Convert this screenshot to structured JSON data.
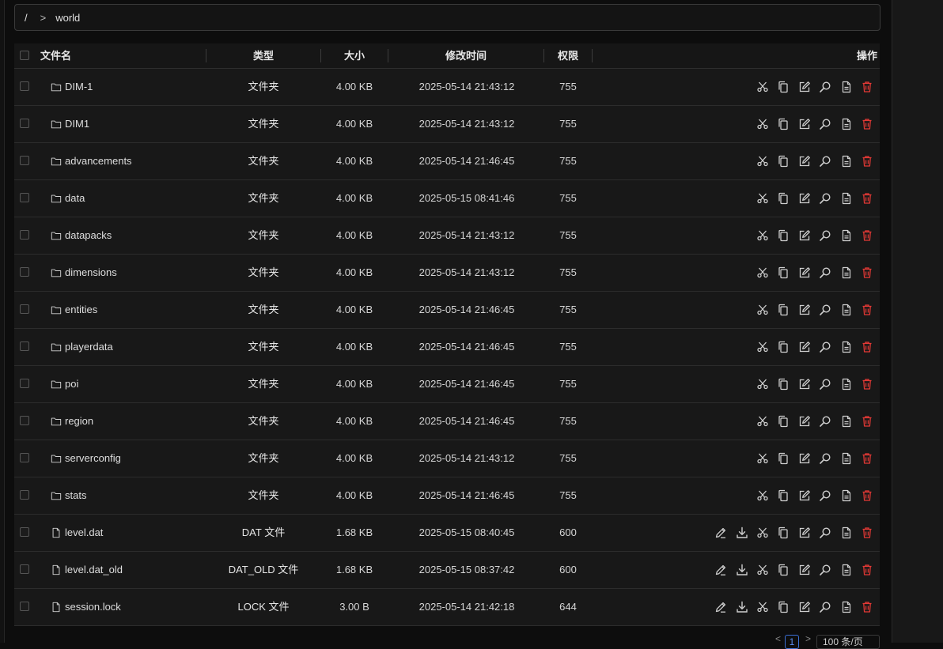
{
  "breadcrumb": {
    "root": "/",
    "separator": ">",
    "current": "world"
  },
  "table": {
    "headers": {
      "name": "文件名",
      "type": "类型",
      "size": "大小",
      "modified": "修改时间",
      "permission": "权限",
      "actions": "操作"
    },
    "rows": [
      {
        "name": "DIM-1",
        "kind": "folder",
        "type": "文件夹",
        "size": "4.00 KB",
        "modified": "2025-05-14 21:43:12",
        "permission": "755"
      },
      {
        "name": "DIM1",
        "kind": "folder",
        "type": "文件夹",
        "size": "4.00 KB",
        "modified": "2025-05-14 21:43:12",
        "permission": "755"
      },
      {
        "name": "advancements",
        "kind": "folder",
        "type": "文件夹",
        "size": "4.00 KB",
        "modified": "2025-05-14 21:46:45",
        "permission": "755"
      },
      {
        "name": "data",
        "kind": "folder",
        "type": "文件夹",
        "size": "4.00 KB",
        "modified": "2025-05-15 08:41:46",
        "permission": "755"
      },
      {
        "name": "datapacks",
        "kind": "folder",
        "type": "文件夹",
        "size": "4.00 KB",
        "modified": "2025-05-14 21:43:12",
        "permission": "755"
      },
      {
        "name": "dimensions",
        "kind": "folder",
        "type": "文件夹",
        "size": "4.00 KB",
        "modified": "2025-05-14 21:43:12",
        "permission": "755"
      },
      {
        "name": "entities",
        "kind": "folder",
        "type": "文件夹",
        "size": "4.00 KB",
        "modified": "2025-05-14 21:46:45",
        "permission": "755"
      },
      {
        "name": "playerdata",
        "kind": "folder",
        "type": "文件夹",
        "size": "4.00 KB",
        "modified": "2025-05-14 21:46:45",
        "permission": "755"
      },
      {
        "name": "poi",
        "kind": "folder",
        "type": "文件夹",
        "size": "4.00 KB",
        "modified": "2025-05-14 21:46:45",
        "permission": "755"
      },
      {
        "name": "region",
        "kind": "folder",
        "type": "文件夹",
        "size": "4.00 KB",
        "modified": "2025-05-14 21:46:45",
        "permission": "755"
      },
      {
        "name": "serverconfig",
        "kind": "folder",
        "type": "文件夹",
        "size": "4.00 KB",
        "modified": "2025-05-14 21:43:12",
        "permission": "755"
      },
      {
        "name": "stats",
        "kind": "folder",
        "type": "文件夹",
        "size": "4.00 KB",
        "modified": "2025-05-14 21:46:45",
        "permission": "755"
      },
      {
        "name": "level.dat",
        "kind": "file",
        "type": "DAT 文件",
        "size": "1.68 KB",
        "modified": "2025-05-15 08:40:45",
        "permission": "600"
      },
      {
        "name": "level.dat_old",
        "kind": "file",
        "type": "DAT_OLD 文件",
        "size": "1.68 KB",
        "modified": "2025-05-15 08:37:42",
        "permission": "600"
      },
      {
        "name": "session.lock",
        "kind": "file",
        "type": "LOCK 文件",
        "size": "3.00 B",
        "modified": "2025-05-14 21:42:18",
        "permission": "644"
      }
    ],
    "folder_actions": [
      "scissors-icon",
      "copy-icon",
      "rename-icon",
      "search-icon",
      "file-details-icon",
      "delete-icon"
    ],
    "file_actions": [
      "edit-icon",
      "download-icon",
      "scissors-icon",
      "copy-icon",
      "rename-icon",
      "search-icon",
      "file-details-icon",
      "delete-icon"
    ]
  },
  "pagination": {
    "prev": "<",
    "page": "1",
    "next": ">",
    "page_size": "100 条/页"
  },
  "colors": {
    "background": "#0d0d0d",
    "row": "#181818",
    "delete": "#e53935",
    "page_active": "#3b6fd4"
  }
}
